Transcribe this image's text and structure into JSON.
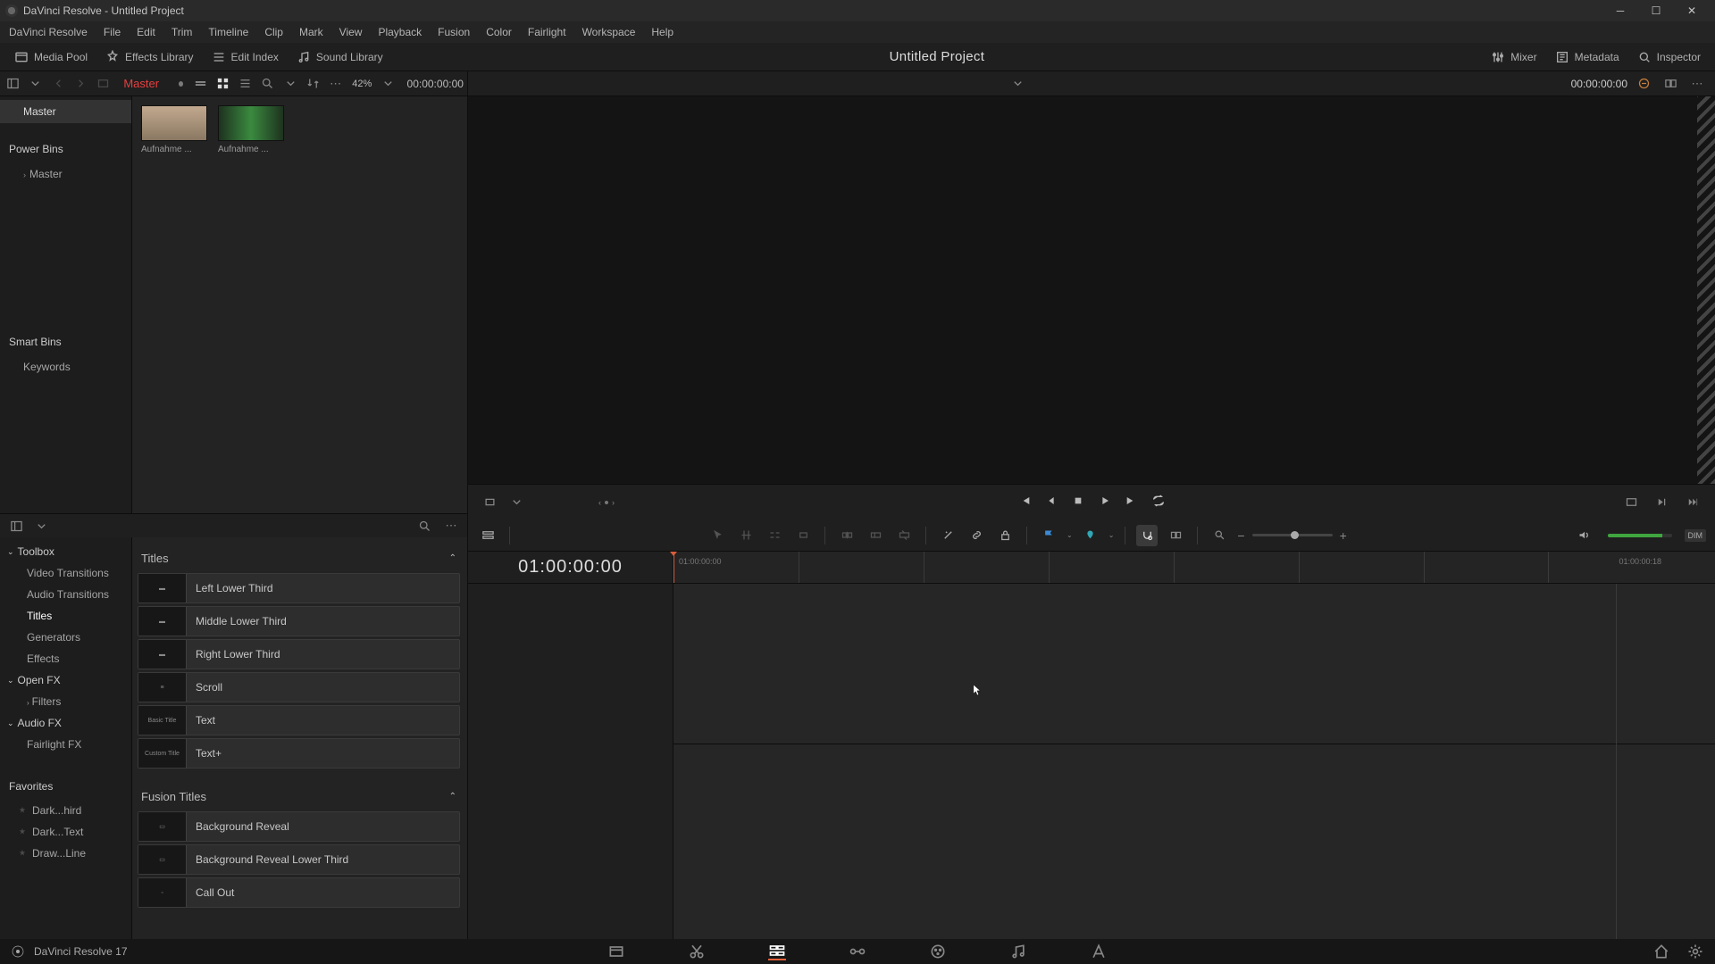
{
  "window_title": "DaVinci Resolve - Untitled Project",
  "menu": [
    "DaVinci Resolve",
    "File",
    "Edit",
    "Trim",
    "Timeline",
    "Clip",
    "Mark",
    "View",
    "Playback",
    "Fusion",
    "Color",
    "Fairlight",
    "Workspace",
    "Help"
  ],
  "ws_left": [
    {
      "id": "media-pool",
      "label": "Media Pool"
    },
    {
      "id": "effects-library",
      "label": "Effects Library"
    },
    {
      "id": "edit-index",
      "label": "Edit Index"
    },
    {
      "id": "sound-library",
      "label": "Sound Library"
    }
  ],
  "project_title": "Untitled Project",
  "ws_right": [
    {
      "id": "mixer",
      "label": "Mixer"
    },
    {
      "id": "metadata",
      "label": "Metadata"
    },
    {
      "id": "inspector",
      "label": "Inspector"
    }
  ],
  "pool": {
    "breadcrumb": "Master",
    "zoom": "42%",
    "timecode": "00:00:00:00",
    "bins": {
      "master": "Master",
      "power_bins_hdr": "Power Bins",
      "power_bins_item": "Master",
      "smart_bins_hdr": "Smart Bins",
      "smart_bins_item": "Keywords"
    },
    "clips": [
      {
        "label": "Aufnahme ..."
      },
      {
        "label": "Aufnahme ..."
      }
    ]
  },
  "viewer_tc_right": "00:00:00:00",
  "fx": {
    "tree": {
      "toolbox": "Toolbox",
      "video_transitions": "Video Transitions",
      "audio_transitions": "Audio Transitions",
      "titles": "Titles",
      "generators": "Generators",
      "effects": "Effects",
      "openfx": "Open FX",
      "filters": "Filters",
      "audiofx": "Audio FX",
      "fairlightfx": "Fairlight FX",
      "favorites_hdr": "Favorites",
      "fav1": "Dark...hird",
      "fav2": "Dark...Text",
      "fav3": "Draw...Line"
    },
    "section_titles": "Titles",
    "section_fusion_titles": "Fusion Titles",
    "titles": [
      {
        "label": "Left Lower Third"
      },
      {
        "label": "Middle Lower Third"
      },
      {
        "label": "Right Lower Third"
      },
      {
        "label": "Scroll"
      },
      {
        "label": "Text",
        "thumb": "Basic Title"
      },
      {
        "label": "Text+",
        "thumb": "Custom Title"
      }
    ],
    "fusion_titles": [
      {
        "label": "Background Reveal"
      },
      {
        "label": "Background Reveal Lower Third"
      },
      {
        "label": "Call Out"
      }
    ]
  },
  "timeline": {
    "timecode": "01:00:00:00",
    "ruler_start": "01:00:00:00",
    "ruler_end": "01:00:00:18"
  },
  "status": "DaVinci Resolve 17"
}
